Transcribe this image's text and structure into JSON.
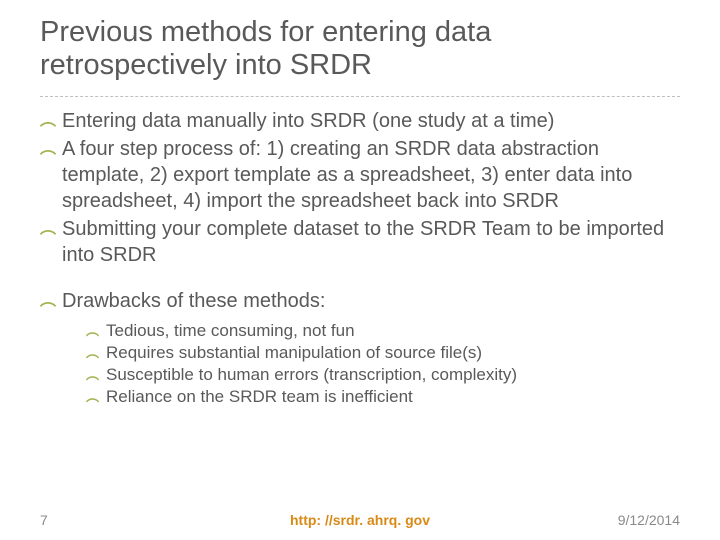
{
  "title": "Previous methods for entering data retrospectively into SRDR",
  "bullets": [
    "Entering data manually into SRDR (one study at a time)",
    "A four step process of: 1) creating an SRDR data abstraction template, 2) export template as a spreadsheet, 3) enter data into spreadsheet, 4) import the spreadsheet back into SRDR",
    "Submitting your complete dataset to the SRDR Team to be imported into SRDR"
  ],
  "drawbacks_label": "Drawbacks of these methods:",
  "drawbacks": [
    "Tedious, time consuming, not fun",
    "Requires substantial manipulation of source file(s)",
    "Susceptible to human errors (transcription, complexity)",
    "Reliance on the SRDR team is inefficient"
  ],
  "footer": {
    "page": "7",
    "url": "http: //srdr. ahrq. gov",
    "date": "9/12/2014"
  },
  "marker": "︵"
}
